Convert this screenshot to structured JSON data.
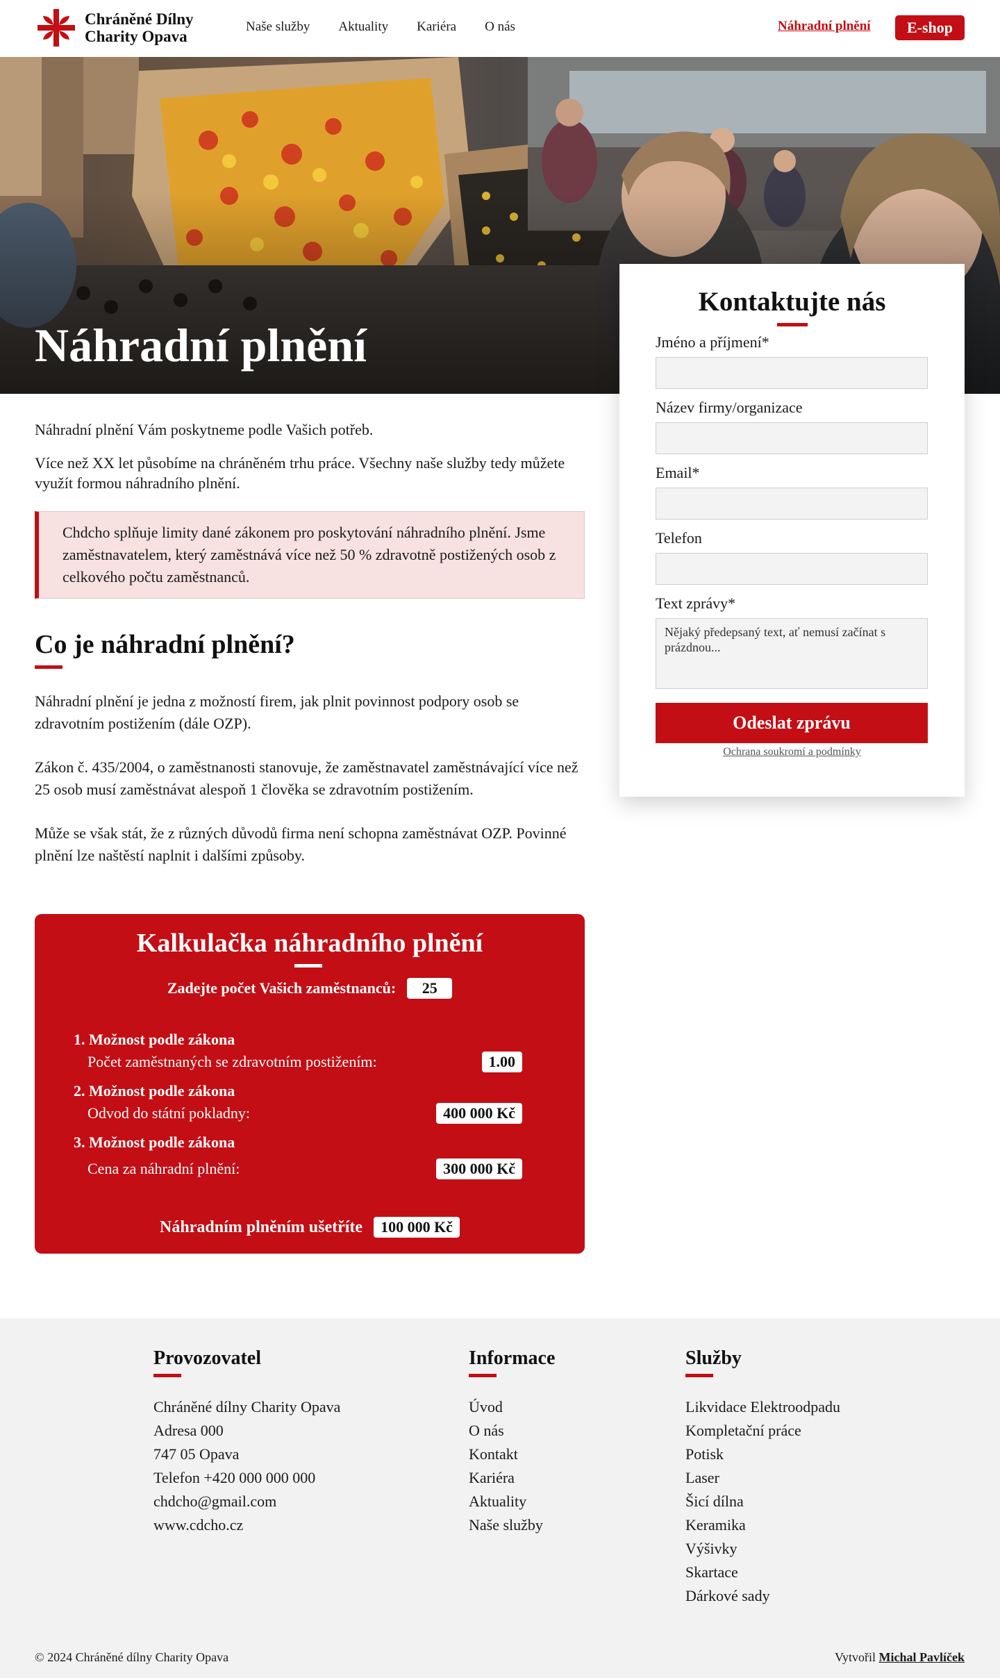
{
  "brand": {
    "name_line1": "Chráněné Dílny",
    "name_line2": "Charity Opava",
    "accent": "#c20e14"
  },
  "nav": {
    "items": [
      "Naše služby",
      "Aktuality",
      "Kariéra",
      "O nás"
    ],
    "active": "Náhradní plnění",
    "eshop": "E-shop"
  },
  "hero": {
    "title": "Náhradní plnění"
  },
  "contact": {
    "title": "Kontaktujte nás",
    "fields": [
      {
        "label": "Jméno a příjmení*",
        "value": ""
      },
      {
        "label": "Název firmy/organizace",
        "value": ""
      },
      {
        "label": "Email*",
        "value": ""
      },
      {
        "label": "Telefon",
        "value": ""
      }
    ],
    "message_label": "Text zprávy*",
    "message_value": "Nějaký předepsaný text, ať nemusí začínat s prázdnou...",
    "submit": "Odeslat zprávu",
    "privacy": "Ochrana soukromí a podmínky"
  },
  "intro": {
    "p1": "Náhradní plnění Vám poskytneme podle Vašich potřeb.",
    "p2": "Více než XX let působíme na chráněném trhu práce. Všechny naše služby tedy můžete využít formou náhradního plnění.",
    "notice": "Chdcho splňuje limity dané zákonem pro poskytování náhradního plnění. Jsme zaměstnavatelem, který zaměstnává více než 50 % zdravotně postižených osob z celkového počtu zaměstnanců."
  },
  "section": {
    "title": "Co je náhradní plnění?",
    "p1": "Náhradní plnění je jedna z možností firem, jak plnit povinnost podpory osob se zdravotním postižením (dále OZP).",
    "p2": "Zákon č. 435/2004, o zaměstnanosti stanovuje, že zaměstnavatel zaměstnávající více než 25 osob musí zaměstnávat alespoň 1 člověka se zdravotním postižením.",
    "p3": "Může se však stát, že z různých důvodů firma není schopna zaměstnávat OZP. Povinné plnění lze naštěstí naplnit i dalšími způsoby."
  },
  "calculator": {
    "title": "Kalkulačka náhradního plnění",
    "employees_label": "Zadejte počet Vašich zaměstnanců:",
    "employees_value": "25",
    "options": [
      {
        "title": "1. Možnost podle zákona",
        "label": "Počet zaměstnaných se zdravotním postižením:",
        "value": "1.00"
      },
      {
        "title": "2. Možnost podle zákona",
        "label": "Odvod do státní pokladny:",
        "value": "400 000 Kč"
      },
      {
        "title": "3. Možnost podle zákona",
        "label": "Cena za náhradní plnění:",
        "value": "300 000 Kč"
      }
    ],
    "savings_label": "Náhradním plněním ušetříte",
    "savings_value": "100 000 Kč"
  },
  "footer": {
    "col1": {
      "title": "Provozovatel",
      "items": [
        "Chráněné dílny Charity Opava",
        "Adresa 000",
        "747 05 Opava",
        "Telefon +420 000 000 000",
        "chdcho@gmail.com",
        "www.cdcho.cz"
      ]
    },
    "col2": {
      "title": "Informace",
      "items": [
        "Úvod",
        "O nás",
        "Kontakt",
        "Kariéra",
        "Aktuality",
        "Naše služby"
      ]
    },
    "col3": {
      "title": "Služby",
      "items": [
        "Likvidace Elektroodpadu",
        "Kompletační práce",
        "Potisk",
        "Laser",
        "Šicí dílna",
        "Keramika",
        "Výšivky",
        "Skartace",
        "Dárkové sady"
      ]
    },
    "copyright": "© 2024 Chráněné dílny Charity Opava",
    "credit_prefix": "Vytvořil",
    "credit_name": "Michal Pavlíček"
  }
}
